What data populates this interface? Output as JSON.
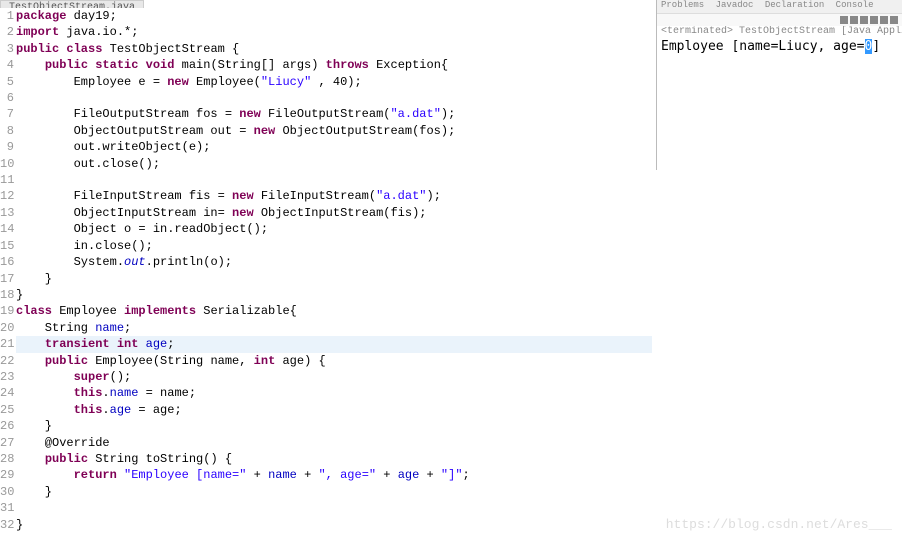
{
  "tab": {
    "title": "TestObjectStream.java"
  },
  "code": {
    "lines": [
      {
        "n": 1,
        "h": [
          [
            "kw",
            "package"
          ],
          [
            "p",
            " day19;"
          ]
        ]
      },
      {
        "n": 2,
        "h": [
          [
            "kw",
            "import"
          ],
          [
            "p",
            " java.io.*;"
          ]
        ]
      },
      {
        "n": 3,
        "h": [
          [
            "kw",
            "public class"
          ],
          [
            "p",
            " TestObjectStream {"
          ]
        ]
      },
      {
        "n": 4,
        "h": [
          [
            "p",
            "    "
          ],
          [
            "kw",
            "public static void"
          ],
          [
            "p",
            " main(String[] args) "
          ],
          [
            "kw",
            "throws"
          ],
          [
            "p",
            " Exception{"
          ]
        ]
      },
      {
        "n": 5,
        "h": [
          [
            "p",
            "        Employee e = "
          ],
          [
            "kw",
            "new"
          ],
          [
            "p",
            " Employee("
          ],
          [
            "str",
            "\"Liucy\""
          ],
          [
            "p",
            " , 40);"
          ]
        ]
      },
      {
        "n": 6,
        "h": [
          [
            "p",
            ""
          ]
        ]
      },
      {
        "n": 7,
        "h": [
          [
            "p",
            "        FileOutputStream fos = "
          ],
          [
            "kw",
            "new"
          ],
          [
            "p",
            " FileOutputStream("
          ],
          [
            "str",
            "\"a.dat\""
          ],
          [
            "p",
            ");"
          ]
        ]
      },
      {
        "n": 8,
        "h": [
          [
            "p",
            "        ObjectOutputStream out = "
          ],
          [
            "kw",
            "new"
          ],
          [
            "p",
            " ObjectOutputStream(fos);"
          ]
        ]
      },
      {
        "n": 9,
        "h": [
          [
            "p",
            "        out.writeObject(e);"
          ]
        ]
      },
      {
        "n": 10,
        "h": [
          [
            "p",
            "        out.close();"
          ]
        ]
      },
      {
        "n": 11,
        "h": [
          [
            "p",
            ""
          ]
        ]
      },
      {
        "n": 12,
        "h": [
          [
            "p",
            "        FileInputStream fis = "
          ],
          [
            "kw",
            "new"
          ],
          [
            "p",
            " FileInputStream("
          ],
          [
            "str",
            "\"a.dat\""
          ],
          [
            "p",
            ");"
          ]
        ]
      },
      {
        "n": 13,
        "h": [
          [
            "p",
            "        ObjectInputStream in= "
          ],
          [
            "kw",
            "new"
          ],
          [
            "p",
            " ObjectInputStream(fis);"
          ]
        ]
      },
      {
        "n": 14,
        "h": [
          [
            "p",
            "        Object o = in.readObject();"
          ]
        ]
      },
      {
        "n": 15,
        "h": [
          [
            "p",
            "        in.close();"
          ]
        ]
      },
      {
        "n": 16,
        "h": [
          [
            "p",
            "        System."
          ],
          [
            "stat",
            "out"
          ],
          [
            "p",
            ".println(o);"
          ]
        ]
      },
      {
        "n": 17,
        "h": [
          [
            "p",
            "    }"
          ]
        ]
      },
      {
        "n": 18,
        "h": [
          [
            "p",
            "}"
          ]
        ]
      },
      {
        "n": 19,
        "h": [
          [
            "kw",
            "class"
          ],
          [
            "p",
            " Employee "
          ],
          [
            "kw",
            "implements"
          ],
          [
            "p",
            " Serializable{"
          ]
        ]
      },
      {
        "n": 20,
        "h": [
          [
            "p",
            "    String "
          ],
          [
            "fld",
            "name"
          ],
          [
            "p",
            ";"
          ]
        ]
      },
      {
        "n": 21,
        "hl": true,
        "h": [
          [
            "p",
            "    "
          ],
          [
            "kw",
            "transient int"
          ],
          [
            "p",
            " "
          ],
          [
            "fld",
            "age"
          ],
          [
            "p",
            ";"
          ]
        ]
      },
      {
        "n": 22,
        "h": [
          [
            "p",
            "    "
          ],
          [
            "kw",
            "public"
          ],
          [
            "p",
            " Employee(String name, "
          ],
          [
            "kw",
            "int"
          ],
          [
            "p",
            " age) {"
          ]
        ]
      },
      {
        "n": 23,
        "h": [
          [
            "p",
            "        "
          ],
          [
            "kw",
            "super"
          ],
          [
            "p",
            "();"
          ]
        ]
      },
      {
        "n": 24,
        "h": [
          [
            "p",
            "        "
          ],
          [
            "kw",
            "this"
          ],
          [
            "p",
            "."
          ],
          [
            "fld",
            "name"
          ],
          [
            "p",
            " = name;"
          ]
        ]
      },
      {
        "n": 25,
        "h": [
          [
            "p",
            "        "
          ],
          [
            "kw",
            "this"
          ],
          [
            "p",
            "."
          ],
          [
            "fld",
            "age"
          ],
          [
            "p",
            " = age;"
          ]
        ]
      },
      {
        "n": 26,
        "h": [
          [
            "p",
            "    }"
          ]
        ]
      },
      {
        "n": 27,
        "h": [
          [
            "p",
            "    @Override"
          ]
        ]
      },
      {
        "n": 28,
        "h": [
          [
            "p",
            "    "
          ],
          [
            "kw",
            "public"
          ],
          [
            "p",
            " String toString() {"
          ]
        ]
      },
      {
        "n": 29,
        "h": [
          [
            "p",
            "        "
          ],
          [
            "kw",
            "return"
          ],
          [
            "p",
            " "
          ],
          [
            "str",
            "\"Employee [name=\""
          ],
          [
            "p",
            " + "
          ],
          [
            "fld",
            "name"
          ],
          [
            "p",
            " + "
          ],
          [
            "str",
            "\", age=\""
          ],
          [
            "p",
            " + "
          ],
          [
            "fld",
            "age"
          ],
          [
            "p",
            " + "
          ],
          [
            "str",
            "\"]\""
          ],
          [
            "p",
            ";"
          ]
        ]
      },
      {
        "n": 30,
        "h": [
          [
            "p",
            "    }"
          ]
        ]
      },
      {
        "n": 31,
        "h": [
          [
            "p",
            ""
          ]
        ]
      },
      {
        "n": 32,
        "h": [
          [
            "p",
            "}"
          ]
        ]
      }
    ]
  },
  "console": {
    "tabs": [
      "Problems",
      "Javadoc",
      "Declaration",
      "Console"
    ],
    "status": "<terminated> TestObjectStream [Java Application] C:\\Program F",
    "output_prefix": "Employee [name=Liucy, age=",
    "output_selected": "0",
    "output_suffix": "]"
  },
  "watermark": "https://blog.csdn.net/Ares___"
}
